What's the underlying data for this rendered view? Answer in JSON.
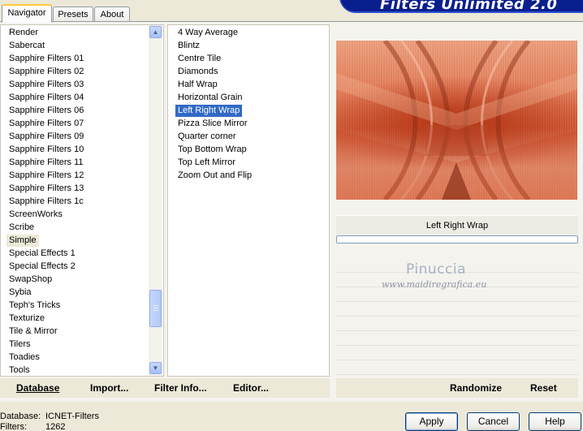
{
  "app": {
    "title": "Filters Unlimited 2.0"
  },
  "tabs": [
    {
      "label": "Navigator",
      "active": true
    },
    {
      "label": "Presets",
      "active": false
    },
    {
      "label": "About",
      "active": false
    }
  ],
  "categories": {
    "items": [
      "Render",
      "Sabercat",
      "Sapphire Filters 01",
      "Sapphire Filters 02",
      "Sapphire Filters 03",
      "Sapphire Filters 04",
      "Sapphire Filters 06",
      "Sapphire Filters 07",
      "Sapphire Filters 09",
      "Sapphire Filters 10",
      "Sapphire Filters 11",
      "Sapphire Filters 12",
      "Sapphire Filters 13",
      "Sapphire Filters 1c",
      "ScreenWorks",
      "Scribe",
      "Simple",
      "Special Effects 1",
      "Special Effects 2",
      "SwapShop",
      "Sybia",
      "Teph's Tricks",
      "Texturize",
      "Tile & Mirror",
      "Tilers",
      "Toadies",
      "Tools"
    ],
    "current": "Simple"
  },
  "filters": {
    "items": [
      "4 Way Average",
      "Blintz",
      "Centre Tile",
      "Diamonds",
      "Half Wrap",
      "Horizontal Grain",
      "Left Right Wrap",
      "Pizza Slice Mirror",
      "Quarter corner",
      "Top Bottom Wrap",
      "Top Left Mirror",
      "Zoom Out and Flip"
    ],
    "selected": "Left Right Wrap"
  },
  "preview": {
    "filter_name": "Left Right Wrap",
    "watermark": "Pinuccia",
    "watermark_sub": "www.maidiregrafica.eu"
  },
  "buttons": {
    "database": "Database",
    "import": "Import...",
    "filter_info": "Filter Info...",
    "editor": "Editor...",
    "randomize": "Randomize",
    "reset": "Reset",
    "apply": "Apply",
    "cancel": "Cancel",
    "help": "Help"
  },
  "footer": {
    "database_label": "Database:",
    "database_value": "ICNET-Filters",
    "filters_label": "Filters:",
    "filters_value": "1262"
  },
  "colors": {
    "selection": "#316ac5",
    "banner": "#0a1f8e",
    "preview_accent": "#d05a36"
  }
}
